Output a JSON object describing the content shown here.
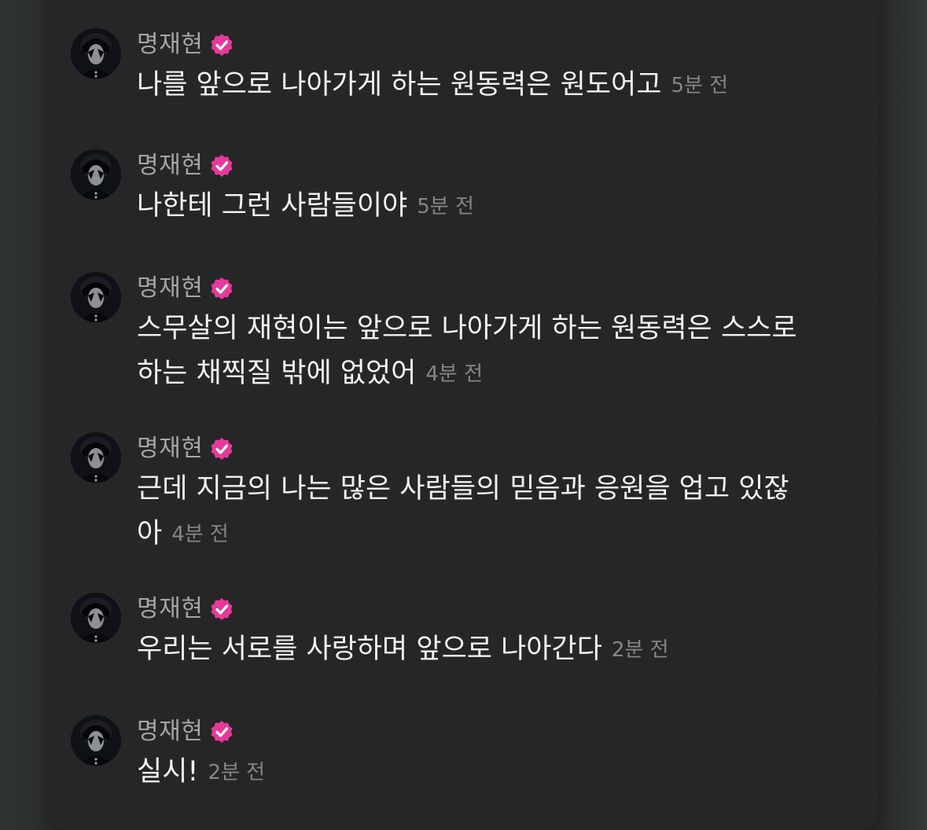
{
  "messages": [
    {
      "name": "명재현",
      "text": "나를 앞으로 나아가게 하는 원동력은 원도어고",
      "time": "5분 전"
    },
    {
      "name": "명재현",
      "text": "나한테 그런 사람들이야",
      "time": "5분 전"
    },
    {
      "name": "명재현",
      "text": "스무살의 재현이는 앞으로 나아가게 하는 원동력은 스스로 하는 채찍질 밖에 없었어",
      "time": "4분 전"
    },
    {
      "name": "명재현",
      "text": "근데 지금의 나는 많은 사람들의 믿음과 응원을 업고 있잖아",
      "time": "4분 전"
    },
    {
      "name": "명재현",
      "text": "우리는 서로를 사랑하며 앞으로 나아간다",
      "time": "2분 전"
    },
    {
      "name": "명재현",
      "text": "실시!",
      "time": "2분 전"
    }
  ],
  "icons": {
    "avatar": "profile-photo",
    "verified": "verified-badge-icon"
  },
  "colors": {
    "background": "#262626",
    "verified_badge": "#e6399b",
    "name_text": "#a6a6a6",
    "message_text": "#f2f2f2",
    "time_text": "#858585"
  }
}
